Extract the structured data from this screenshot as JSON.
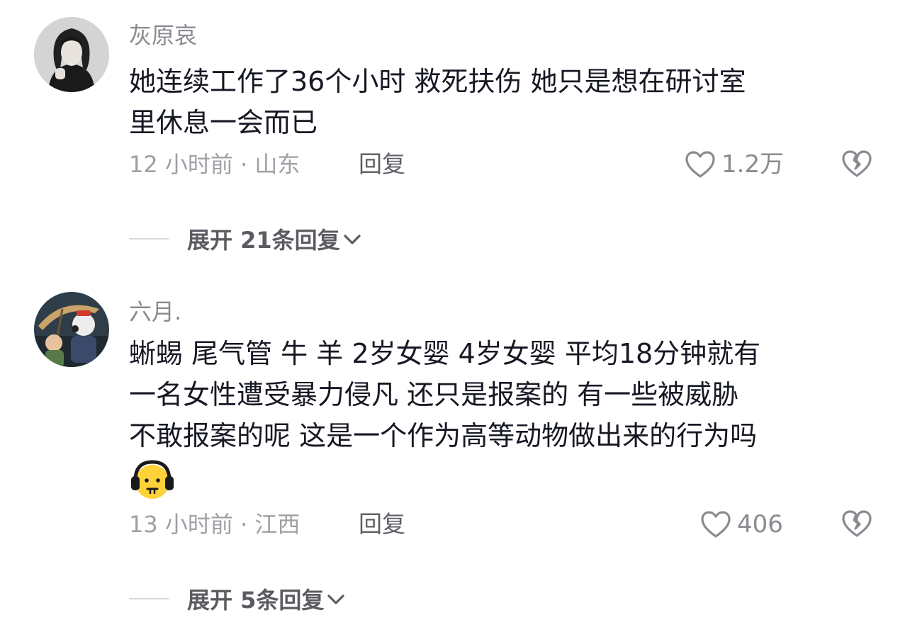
{
  "comments": [
    {
      "username": "灰原哀",
      "text_line1": "她连续工作了36个小时 救死扶伤 她只是想在研讨室",
      "text_line2": "里休息一会而已",
      "meta": "12 小时前 · 山东",
      "reply_label": "回复",
      "likes": "1.2万",
      "expand_label": "展开 21条回复"
    },
    {
      "username": "六月.",
      "text_line1": "蜥蜴 尾气管 牛 羊 2岁女婴 4岁女婴 平均18分钟就有",
      "text_line2": "一名女性遭受暴力侵凡 还只是报案的 有一些被威胁",
      "text_line3": "不敢报案的呢 这是一个作为高等动物做出来的行为吗",
      "meta": "13 小时前 · 江西",
      "reply_label": "回复",
      "likes": "406",
      "expand_label": "展开 5条回复"
    }
  ],
  "icons": {
    "like": "heart-outline-icon",
    "dislike": "broken-heart-icon",
    "expand": "chevron-down-icon",
    "emoji": "headphone-face-emoji"
  },
  "colors": {
    "text_primary": "#161823",
    "text_secondary": "#8a8b91",
    "emoji_yellow": "#ffd23a"
  }
}
